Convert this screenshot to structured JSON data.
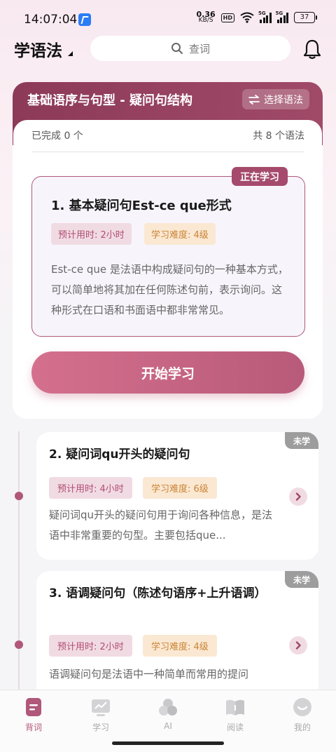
{
  "status_bar": {
    "time": "14:07:04",
    "net_speed_value": "0.36",
    "net_speed_unit": "KB/S",
    "hd_label": "HD",
    "signal_1": "5G",
    "signal_2": "5G",
    "battery": "37"
  },
  "header": {
    "title": "学语法",
    "search_placeholder": "查词"
  },
  "unit": {
    "title": "基础语序与句型 - 疑问句结构",
    "select_label": "选择语法",
    "completed": "已完成 0 个",
    "total": "共 8 个语法"
  },
  "current_lesson": {
    "badge": "正在学习",
    "title": "1. 基本疑问句Est-ce que形式",
    "time_tag": "预计用时: 2小时",
    "difficulty_tag": "学习难度: 4级",
    "description": "Est-ce que 是法语中构成疑问句的一种基本方式，可以简单地将其加在任何陈述句前，表示询问。这种形式在口语和书面语中都非常常见。",
    "start_button": "开始学习"
  },
  "lessons": [
    {
      "status": "未学",
      "title": "2. 疑问词qu开头的疑问句",
      "time_tag": "预计用时: 4小时",
      "difficulty_tag": "学习难度: 6级",
      "description": "疑问词qu开头的疑问句用于询问各种信息，是法语中非常重要的句型。主要包括que..."
    },
    {
      "status": "未学",
      "title": "3. 语调疑问句（陈述句语序+上升语调）",
      "time_tag": "预计用时: 2小时",
      "difficulty_tag": "学习难度: 4级",
      "description": "语调疑问句是法语中一种简单而常用的提问"
    }
  ],
  "nav": [
    {
      "label": "背词",
      "icon": "book-icon",
      "active": true
    },
    {
      "label": "学习",
      "icon": "chart-icon",
      "active": false
    },
    {
      "label": "AI",
      "icon": "ai-icon",
      "active": false
    },
    {
      "label": "阅读",
      "icon": "reading-icon",
      "active": false
    },
    {
      "label": "我的",
      "icon": "profile-icon",
      "active": false
    }
  ],
  "colors": {
    "accent": "#a04a68",
    "accent_light": "#f1dbe3",
    "difficulty_bg": "#fbe8d2",
    "status_gray": "#9d9d9d"
  }
}
